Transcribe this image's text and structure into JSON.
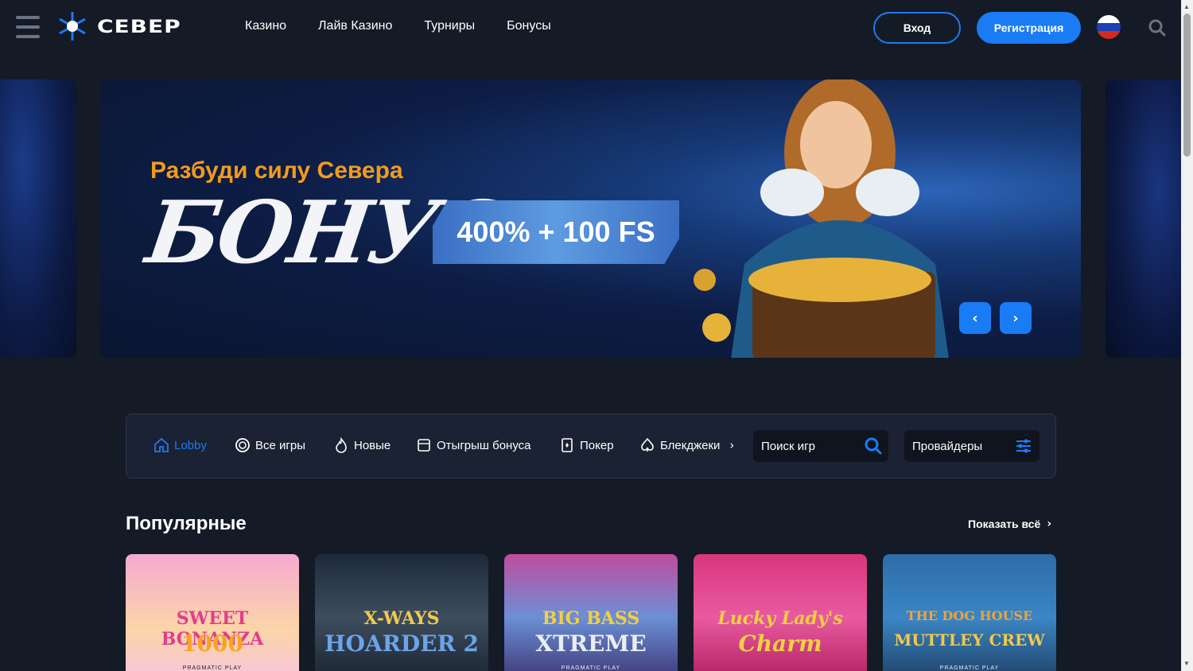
{
  "header": {
    "logo_text": "СЕВЕР",
    "nav": [
      "Казино",
      "Лайв Казино",
      "Турниры",
      "Бонусы"
    ],
    "login_label": "Вход",
    "register_label": "Регистрация"
  },
  "banner": {
    "subtitle": "Разбуди силу Севера",
    "headline": "БОНУС",
    "offer": "400% + 100 FS"
  },
  "categories": [
    {
      "label": "Lobby",
      "icon": "home-icon",
      "active": true
    },
    {
      "label": "Все игры",
      "icon": "chip-icon",
      "active": false
    },
    {
      "label": "Новые",
      "icon": "flame-icon",
      "active": false
    },
    {
      "label": "Отыгрыш бонуса",
      "icon": "slot-icon",
      "active": false
    },
    {
      "label": "Покер",
      "icon": "card-icon",
      "active": false
    },
    {
      "label": "Блекджеки",
      "icon": "spade-icon",
      "active": false
    }
  ],
  "search": {
    "placeholder": "Поиск игр"
  },
  "providers_label": "Провайдеры",
  "popular": {
    "title": "Популярные",
    "show_all": "Показать всё",
    "games": [
      {
        "title": "SWEET BONANZA",
        "sub": "1000",
        "brand": "PRAGMATIC PLAY"
      },
      {
        "title": "X-WAYS",
        "sub": "HOARDER 2",
        "brand": ""
      },
      {
        "title": "BIG BASS",
        "sub": "XTREME",
        "brand": "PRAGMATIC PLAY"
      },
      {
        "title": "Lucky Lady's",
        "sub": "Charm",
        "brand": ""
      },
      {
        "title": "THE DOG HOUSE",
        "sub": "MUTTLEY CREW",
        "brand": "PRAGMATIC PLAY"
      }
    ]
  },
  "colors": {
    "accent": "#1a7cf5",
    "banner_subtitle": "#f29b1d",
    "background": "#141a26"
  }
}
